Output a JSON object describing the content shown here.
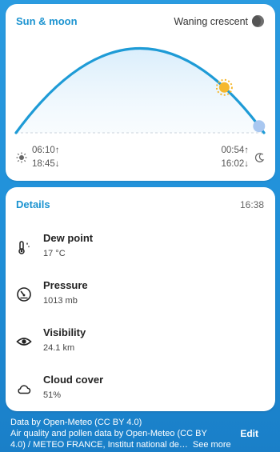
{
  "sun_moon": {
    "title": "Sun & moon",
    "moon_phase": "Waning crescent",
    "sunrise": "06:10↑",
    "sunset": "18:45↓",
    "moonrise": "00:54↑",
    "moonset": "16:02↓",
    "sun_progress": 0.84,
    "moon_progress": 0.98,
    "sun_icon": "sun-icon",
    "moon_icon": "moon-icon"
  },
  "details": {
    "title": "Details",
    "updated": "16:38",
    "items": [
      {
        "name": "Dew point",
        "value": "17 °C",
        "icon": "dew-point-icon"
      },
      {
        "name": "Pressure",
        "value": "1013 mb",
        "icon": "gauge-icon"
      },
      {
        "name": "Visibility",
        "value": "24.1 km",
        "icon": "eye-icon"
      },
      {
        "name": "Cloud cover",
        "value": "51%",
        "icon": "cloud-icon"
      }
    ]
  },
  "footer": {
    "line1": "Data by Open-Meteo (CC BY 4.0)",
    "line2": "Air quality and pollen data by Open-Meteo (CC BY",
    "line3": "4.0) / METEO FRANCE, Institut national de…",
    "see_more": "See more",
    "edit": "Edit"
  },
  "colors": {
    "accent": "#1b93d0",
    "arc": "#1e9bd6",
    "sun": "#f5b82e",
    "moon": "#a9c7f0"
  }
}
